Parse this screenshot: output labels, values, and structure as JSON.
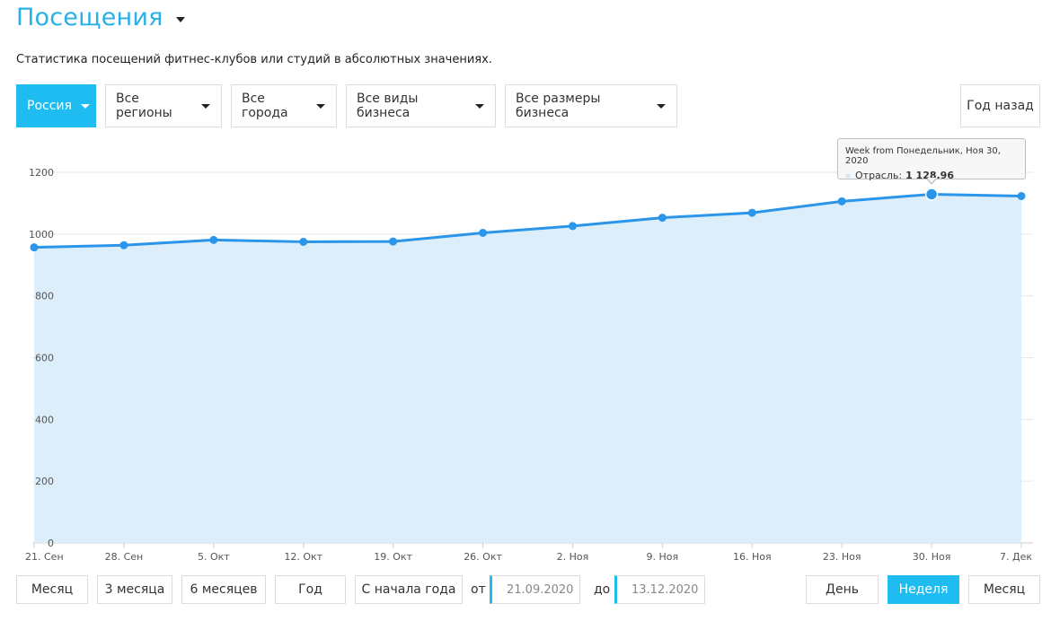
{
  "header": {
    "title": "Посещения",
    "subtitle": "Статистика посещений фитнес-клубов или студий в абсолютных значениях."
  },
  "filters": {
    "country": "Россия",
    "region": "Все регионы",
    "city": "Все города",
    "business_type": "Все виды бизнеса",
    "business_size": "Все размеры бизнеса",
    "compare": "Год назад"
  },
  "tooltip": {
    "title": "Week from Понедельник, Ноя 30, 2020",
    "series": "Отрасль:",
    "value": "1 128.96"
  },
  "period_buttons": {
    "month": "Месяц",
    "three_months": "3 месяца",
    "six_months": "6 месяцев",
    "year": "Год",
    "ytd": "С начала года"
  },
  "range": {
    "from_label": "от",
    "from": "21.09.2020",
    "to_label": "до",
    "to": "13.12.2020"
  },
  "granularity": {
    "day": "День",
    "week": "Неделя",
    "month": "Месяц",
    "selected": "week"
  },
  "colors": {
    "accent": "#1fbcf1",
    "title": "#2ab0e8",
    "line": "#2b95e9",
    "area": "#ddeefb"
  },
  "chart_data": {
    "type": "area",
    "categories": [
      "21. Сен",
      "28. Сен",
      "5. Окт",
      "12. Окт",
      "19. Окт",
      "26. Окт",
      "2. Ноя",
      "9. Ноя",
      "16. Ноя",
      "23. Ноя",
      "30. Ноя",
      "7. Дек"
    ],
    "series": [
      {
        "name": "Отрасль",
        "values": [
          957,
          964,
          981,
          975,
          976,
          1004,
          1026,
          1053,
          1069,
          1106,
          1128.96,
          1123
        ]
      }
    ],
    "ylim": [
      0,
      1200
    ],
    "yticks": [
      0,
      200,
      400,
      600,
      800,
      1000,
      1200
    ],
    "grid": true,
    "highlighted_index": 10
  }
}
